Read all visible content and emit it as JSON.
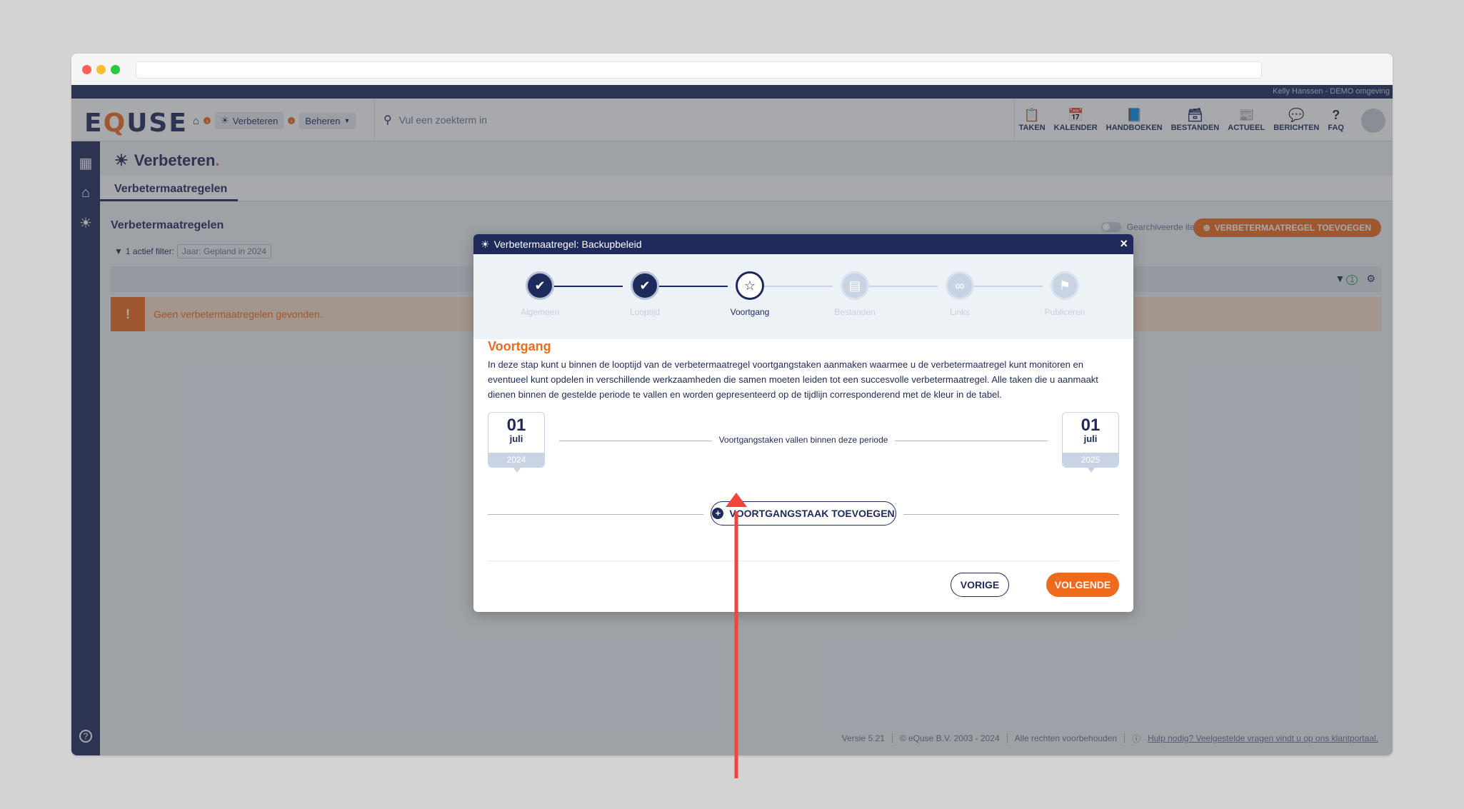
{
  "user_bar": {
    "text": "Kelly Hanssen - DEMO omgeving"
  },
  "logo": {
    "pre": "E",
    "q": "Q",
    "post": "USE"
  },
  "breadcrumb": {
    "home_icon": "home-icon",
    "module": "Verbeteren",
    "dropdown": "Beheren"
  },
  "search": {
    "placeholder": "Vul een zoekterm in"
  },
  "topnav": [
    {
      "label": "TAKEN",
      "icon": "clipboard-icon"
    },
    {
      "label": "KALENDER",
      "icon": "calendar-icon"
    },
    {
      "label": "HANDBOEKEN",
      "icon": "book-icon"
    },
    {
      "label": "BESTANDEN",
      "icon": "archive-icon"
    },
    {
      "label": "ACTUEEL",
      "icon": "news-icon"
    },
    {
      "label": "BERICHTEN",
      "icon": "chat-icon"
    },
    {
      "label": "FAQ",
      "icon": "question-icon"
    }
  ],
  "page": {
    "title": "Verbeteren",
    "title_dot": ".",
    "tab": "Verbetermaatregelen",
    "section_title": "Verbetermaatregelen",
    "filter_label": "1 actief filter:",
    "filter_chip": "Jaar: Gepland in 2024",
    "archived_label": "Gearchiveerde items tonen",
    "add_button": "VERBETERMAATREGEL TOEVOEGEN",
    "filter_count": "1",
    "alert": "Geen verbetermaatregelen gevonden."
  },
  "footer": {
    "version": "Versie 5.21",
    "copyright": "© eQuse B.V. 2003 - 2024",
    "rights": "Alle rechten voorbehouden",
    "help": "Hulp nodig? Veelgestelde vragen vindt u op ons klantportaal."
  },
  "modal": {
    "title": "Verbetermaatregel: Backupbeleid",
    "steps": [
      {
        "label": "Algemeen",
        "state": "done",
        "icon": "check-icon"
      },
      {
        "label": "Looptijd",
        "state": "done",
        "icon": "check-icon"
      },
      {
        "label": "Voortgang",
        "state": "active",
        "icon": "star-icon"
      },
      {
        "label": "Bestanden",
        "state": "todo",
        "icon": "file-icon"
      },
      {
        "label": "Links",
        "state": "todo",
        "icon": "link-icon"
      },
      {
        "label": "Publiceren",
        "state": "todo",
        "icon": "flag-icon"
      }
    ],
    "heading": "Voortgang",
    "description": "In deze stap kunt u binnen de looptijd van de verbetermaatregel voortgangstaken aanmaken waarmee u de verbetermaatregel kunt monitoren en eventueel kunt opdelen in verschillende werkzaamheden die samen moeten leiden tot een succesvolle verbetermaatregel. Alle taken die u aanmaakt dienen binnen de gestelde periode te vallen en worden gepresenteerd op de tijdlijn corresponderend met de kleur in de tabel.",
    "start": {
      "day": "01",
      "month": "juli",
      "year": "2024"
    },
    "end": {
      "day": "01",
      "month": "juli",
      "year": "2025"
    },
    "period_text": "Voortgangstaken vallen binnen deze periode",
    "add_task": "VOORTGANGSTAAK TOEVOEGEN",
    "prev": "VORIGE",
    "next": "VOLGENDE"
  },
  "colors": {
    "navy": "#1f2a5c",
    "orange": "#f06a1d",
    "arrow": "#f2443a"
  }
}
